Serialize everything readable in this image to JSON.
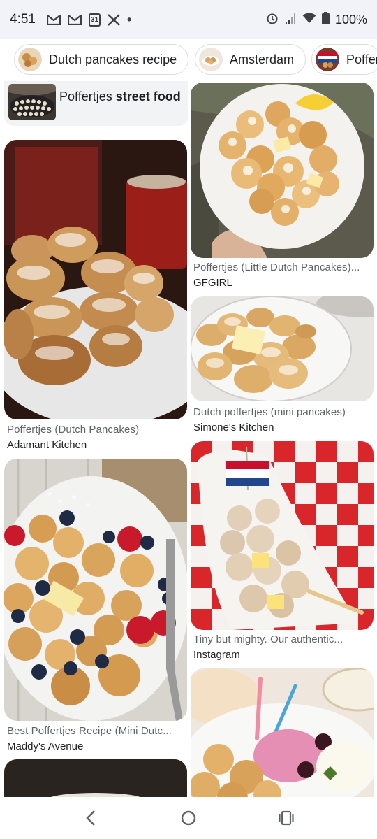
{
  "status_bar": {
    "time": "4:51",
    "notification_icons": [
      "gmail-icon",
      "gmail-icon",
      "calendar-icon",
      "x-icon",
      "dot-icon"
    ],
    "calendar_day": "31",
    "battery": "100%",
    "right_icons": [
      "alarm-icon",
      "signal-icon",
      "wifi-icon",
      "battery-icon"
    ]
  },
  "chips": [
    {
      "label": "Dutch pancakes recipe"
    },
    {
      "label": "Amsterdam"
    },
    {
      "label": "Poffer"
    }
  ],
  "related_search": {
    "prefix": "Poffertjes ",
    "bold": "street food"
  },
  "results": [
    {
      "title": "Poffertjes (Little Dutch Pancakes)...",
      "source": "GFGIRL"
    },
    {
      "title": "Poffertjes (Dutch Pancakes)",
      "source": "Adamant Kitchen"
    },
    {
      "title": "Dutch poffertjes (mini pancakes)",
      "source": "Simone's Kitchen"
    },
    {
      "title": "Tiny but mighty. Our authentic...",
      "source": "Instagram"
    },
    {
      "title": "Best Poffertjes Recipe (Mini Dutc...",
      "source": "Maddy's Avenue"
    }
  ],
  "nav_bar": {
    "icons": [
      "back-icon",
      "home-icon",
      "recents-icon"
    ]
  }
}
